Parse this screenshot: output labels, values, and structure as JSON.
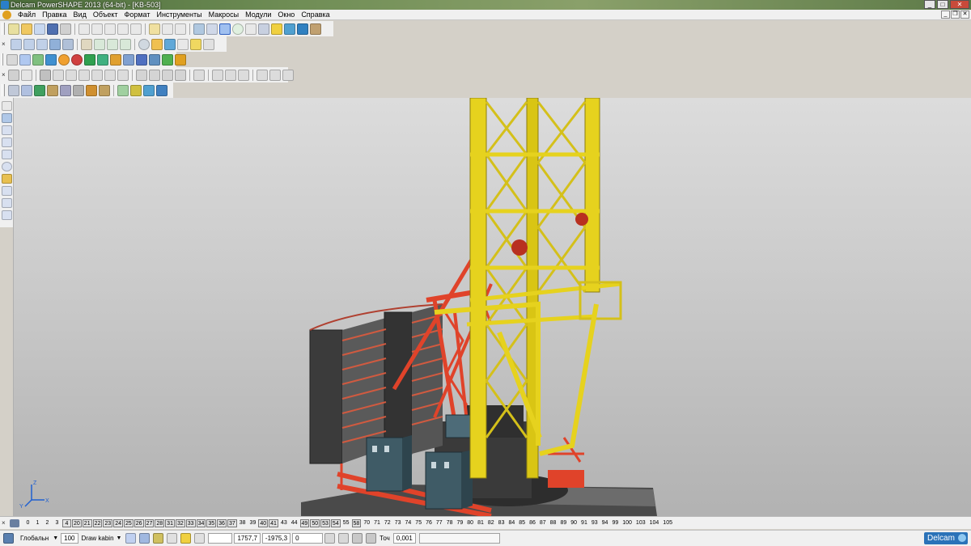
{
  "window": {
    "title": "Delcam PowerSHAPE 2013 (64-bit) - [KB-503]",
    "buttons": {
      "minimize": "_",
      "maximize": "□",
      "close": "✕"
    }
  },
  "menu": {
    "items": [
      "Файл",
      "Правка",
      "Вид",
      "Объект",
      "Формат",
      "Инструменты",
      "Макросы",
      "Модули",
      "Окно",
      "Справка"
    ],
    "mdi_buttons": [
      "_",
      "❐",
      "✕"
    ]
  },
  "toolbars": {
    "close_glyph": "×"
  },
  "levels": {
    "close_glyph": "×",
    "numbers": [
      "0",
      "1",
      "2",
      "3",
      "4",
      "20",
      "21",
      "22",
      "23",
      "24",
      "25",
      "26",
      "27",
      "28",
      "31",
      "32",
      "33",
      "34",
      "35",
      "36",
      "37",
      "38",
      "39",
      "40",
      "41",
      "43",
      "44",
      "49",
      "50",
      "53",
      "54",
      "55",
      "58",
      "70",
      "71",
      "72",
      "73",
      "74",
      "75",
      "76",
      "77",
      "78",
      "79",
      "80",
      "81",
      "82",
      "83",
      "84",
      "85",
      "86",
      "87",
      "88",
      "89",
      "90",
      "91",
      "93",
      "94",
      "99",
      "100",
      "103",
      "104",
      "105"
    ],
    "used": [
      "4",
      "20",
      "21",
      "22",
      "23",
      "24",
      "25",
      "26",
      "27",
      "28",
      "31",
      "32",
      "33",
      "34",
      "35",
      "36",
      "37",
      "40",
      "41",
      "49",
      "50",
      "53",
      "54",
      "58"
    ]
  },
  "status": {
    "workplane": "Глобальн",
    "scale": "100",
    "level_name": "Draw kabin",
    "x": "1757,7",
    "y": "-1975,3",
    "z": "0",
    "tolerance_label": "Точ",
    "tolerance": "0,001",
    "logo": "Delcam"
  },
  "axis": {
    "x": "X",
    "y": "Y",
    "z": "Z"
  },
  "colors": {
    "viewport_top": "#dcdcdc",
    "viewport_bottom": "#b2b2b2",
    "mast_yellow": "#e6d21e",
    "counterjib_red": "#e0432a",
    "cabinet_teal": "#3f5b66",
    "counterweight_dark": "#3d3d3d",
    "brand_blue": "#2a72b8"
  }
}
